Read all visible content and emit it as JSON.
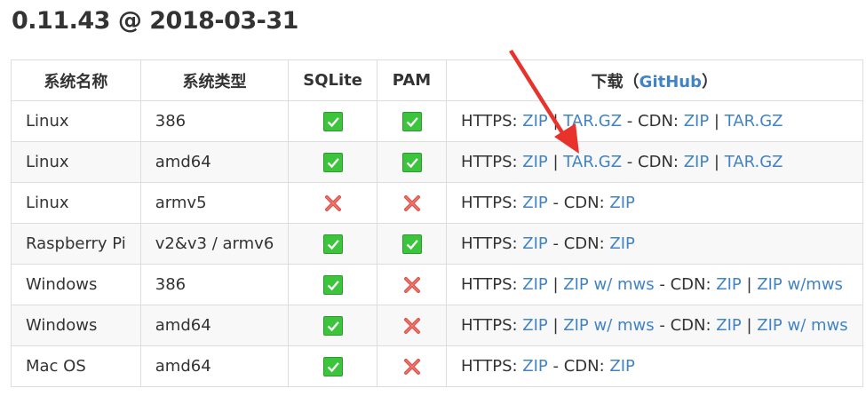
{
  "heading": "0.11.43 @ 2018-03-31",
  "table": {
    "headers": {
      "system_name": "系统名称",
      "system_type": "系统类型",
      "sqlite": "SQLite",
      "pam": "PAM",
      "download_prefix": "下载（",
      "download_link": "GitHub",
      "download_suffix": "）"
    },
    "rows": [
      {
        "os": "Linux",
        "arch": "386",
        "sqlite": true,
        "pam": true,
        "links": [
          {
            "t": "HTTPS: "
          },
          {
            "a": "ZIP"
          },
          {
            "t": " | "
          },
          {
            "a": "TAR.GZ"
          },
          {
            "t": " - CDN: "
          },
          {
            "a": "ZIP"
          },
          {
            "t": " | "
          },
          {
            "a": "TAR.GZ"
          }
        ]
      },
      {
        "os": "Linux",
        "arch": "amd64",
        "sqlite": true,
        "pam": true,
        "links": [
          {
            "t": "HTTPS: "
          },
          {
            "a": "ZIP"
          },
          {
            "t": " | "
          },
          {
            "a": "TAR.GZ"
          },
          {
            "t": " - CDN: "
          },
          {
            "a": "ZIP"
          },
          {
            "t": " | "
          },
          {
            "a": "TAR.GZ"
          }
        ]
      },
      {
        "os": "Linux",
        "arch": "armv5",
        "sqlite": false,
        "pam": false,
        "links": [
          {
            "t": "HTTPS: "
          },
          {
            "a": "ZIP"
          },
          {
            "t": " - CDN: "
          },
          {
            "a": "ZIP"
          }
        ]
      },
      {
        "os": "Raspberry Pi",
        "arch": "v2&v3 / armv6",
        "sqlite": true,
        "pam": true,
        "links": [
          {
            "t": "HTTPS: "
          },
          {
            "a": "ZIP"
          },
          {
            "t": " - CDN: "
          },
          {
            "a": "ZIP"
          }
        ]
      },
      {
        "os": "Windows",
        "arch": "386",
        "sqlite": true,
        "pam": false,
        "links": [
          {
            "t": "HTTPS: "
          },
          {
            "a": "ZIP"
          },
          {
            "t": " | "
          },
          {
            "a": "ZIP w/ mws"
          },
          {
            "t": " - CDN: "
          },
          {
            "a": "ZIP"
          },
          {
            "t": " | "
          },
          {
            "a": "ZIP w/mws"
          }
        ]
      },
      {
        "os": "Windows",
        "arch": "amd64",
        "sqlite": true,
        "pam": false,
        "links": [
          {
            "t": "HTTPS: "
          },
          {
            "a": "ZIP"
          },
          {
            "t": " | "
          },
          {
            "a": "ZIP w/ mws"
          },
          {
            "t": " - CDN: "
          },
          {
            "a": "ZIP"
          },
          {
            "t": " | "
          },
          {
            "a": "ZIP w/ mws"
          }
        ]
      },
      {
        "os": "Mac OS",
        "arch": "amd64",
        "sqlite": true,
        "pam": false,
        "links": [
          {
            "t": "HTTPS: "
          },
          {
            "a": "ZIP"
          },
          {
            "t": " - CDN: "
          },
          {
            "a": "ZIP"
          }
        ]
      }
    ]
  },
  "icons": {
    "supported": "check-icon",
    "unsupported": "cross-icon"
  },
  "colors": {
    "link": "#4183c4",
    "check": "#3cc43c",
    "cross": "#d9534f",
    "arrow": "#e8322c"
  }
}
